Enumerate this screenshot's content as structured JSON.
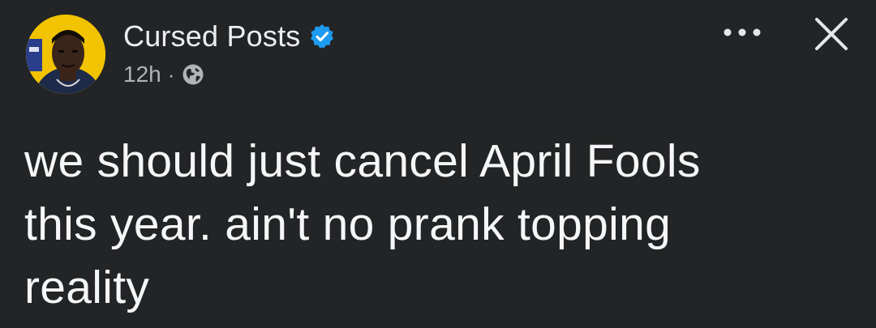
{
  "post": {
    "author_name": "Cursed Posts",
    "verified": true,
    "timestamp": "12h",
    "separator": "·",
    "audience_icon": "globe-icon",
    "body_text": "we should just cancel April Fools\nthis year. ain't no prank topping\nreality"
  },
  "icons": {
    "more": "more-options-icon",
    "close": "close-icon",
    "verified": "verified-badge-icon"
  },
  "colors": {
    "background": "#232425",
    "text_primary": "#f5f6f7",
    "text_secondary": "#b0b3b8",
    "verified_blue": "#1d9bf0",
    "avatar_bg": "#f2c300"
  }
}
